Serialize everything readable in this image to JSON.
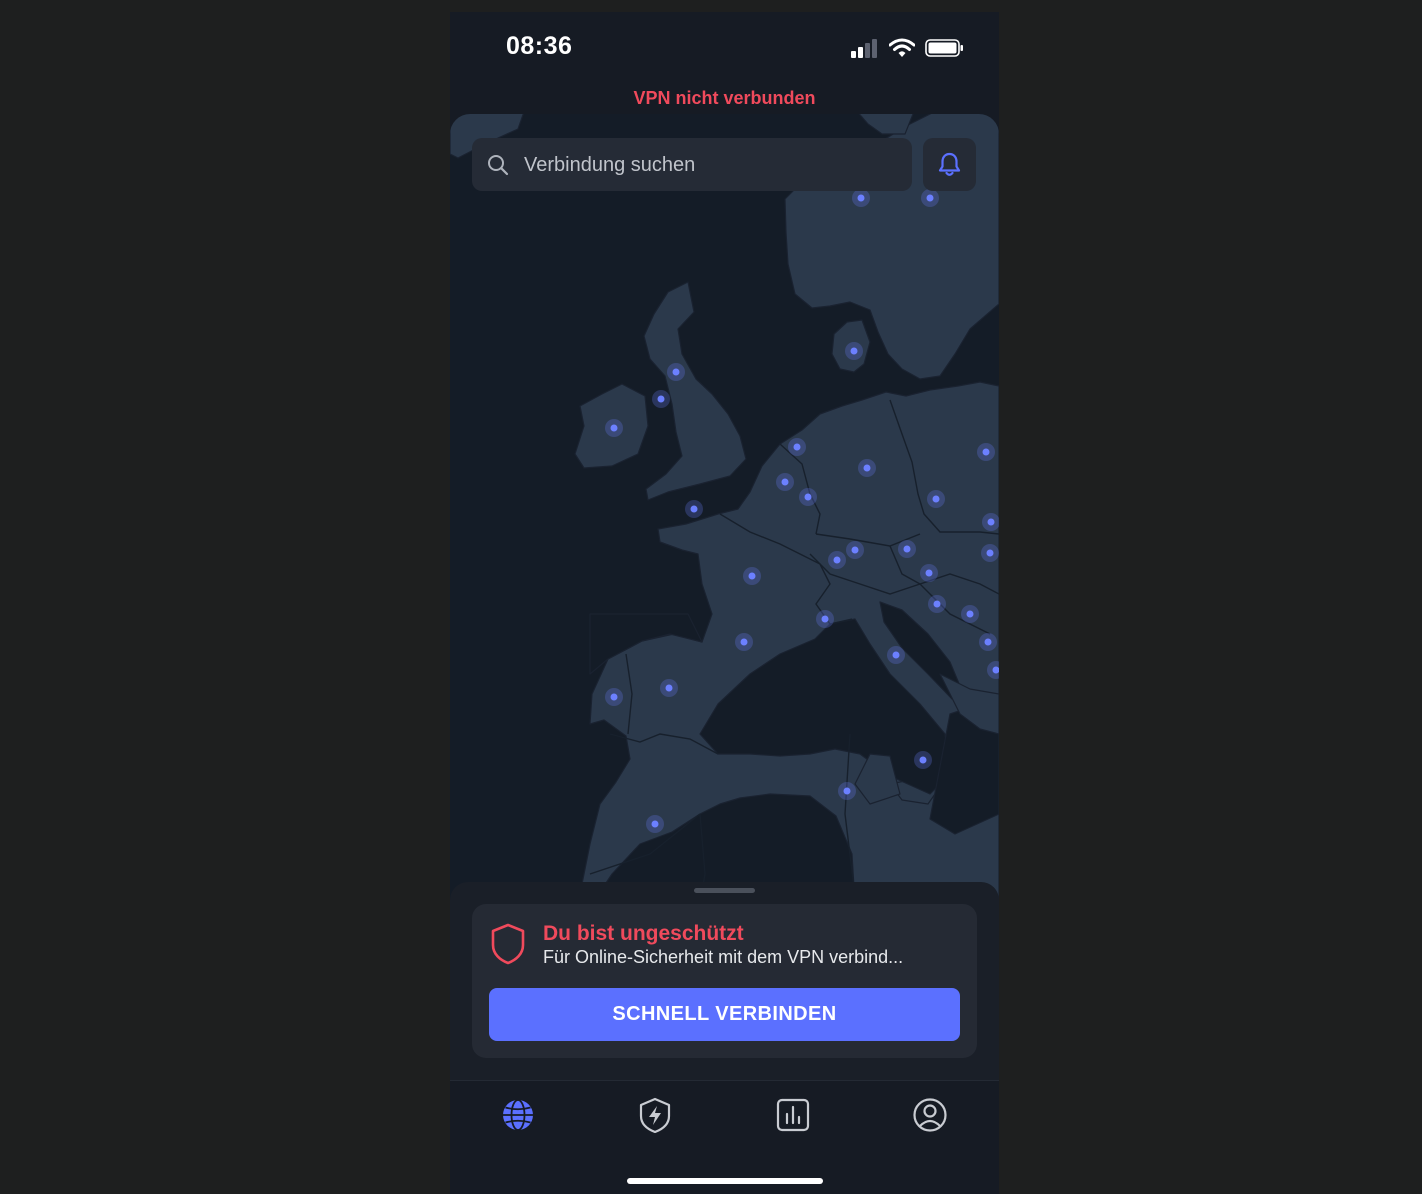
{
  "status_bar": {
    "time": "08:36"
  },
  "vpn_status": "VPN nicht verbunden",
  "search": {
    "placeholder": "Verbindung suchen"
  },
  "status_card": {
    "title": "Du bist ungeschützt",
    "subtitle": "Für Online-Sicherheit mit dem VPN verbind..."
  },
  "connect_button_label": "SCHNELL VERBINDEN",
  "bottom_nav": {
    "items": [
      {
        "icon": "globe-icon",
        "active": true
      },
      {
        "icon": "shield-bolt-icon",
        "active": false
      },
      {
        "icon": "bar-chart-icon",
        "active": false
      },
      {
        "icon": "user-icon",
        "active": false
      }
    ]
  },
  "colors": {
    "background": "#161b24",
    "land": "#2b394b",
    "water": "#141c27",
    "accent": "#5b70ff",
    "warning": "#f04a5c",
    "server_dot": "#6c80ff"
  }
}
